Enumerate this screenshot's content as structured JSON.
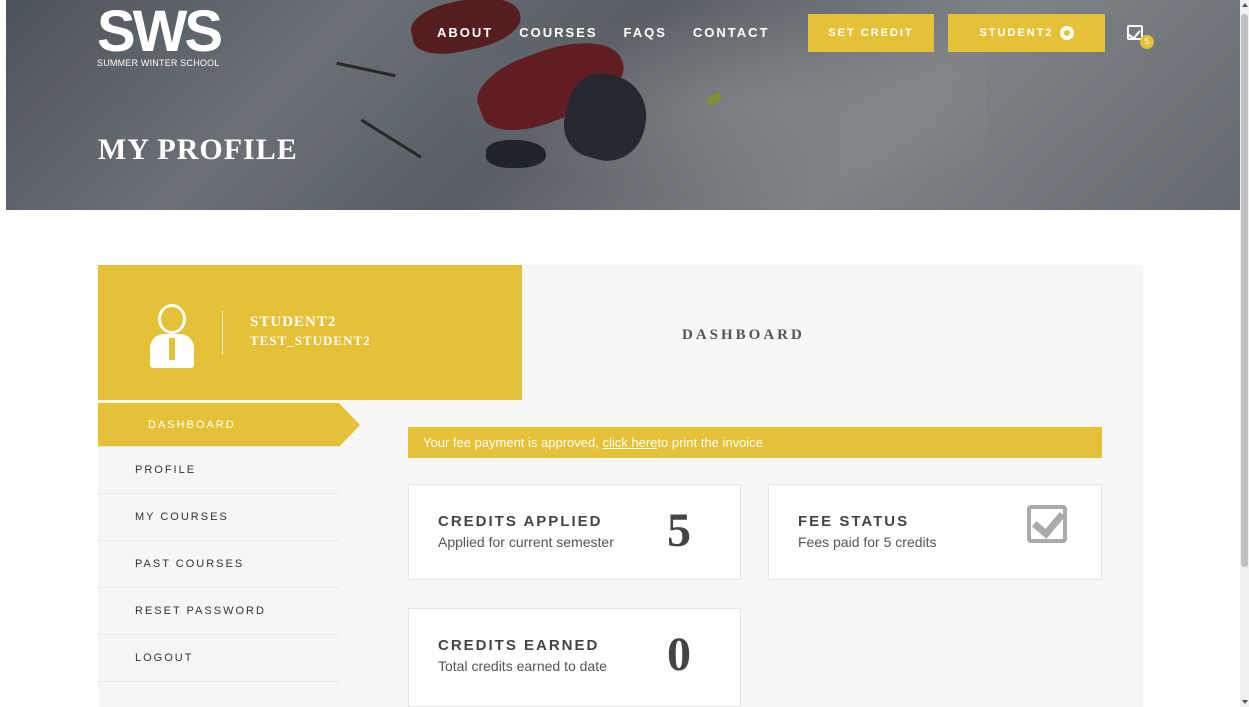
{
  "brand": {
    "logo_text": "SWS",
    "tagline": "SUMMER WINTER SCHOOL"
  },
  "nav": {
    "items": [
      "ABOUT",
      "COURSES",
      "FAQS",
      "CONTACT"
    ],
    "set_credit": "SET CREDIT",
    "user_menu": "STUDENT2",
    "tasks_badge": "5"
  },
  "page": {
    "title": "MY PROFILE"
  },
  "user": {
    "name": "STUDENT2",
    "username": "TEST_STUDENT2"
  },
  "main": {
    "heading": "DASHBOARD"
  },
  "sidebar": {
    "items": [
      {
        "label": "DASHBOARD",
        "active": true
      },
      {
        "label": "PROFILE"
      },
      {
        "label": "MY COURSES"
      },
      {
        "label": "PAST COURSES"
      },
      {
        "label": "RESET PASSWORD"
      },
      {
        "label": "LOGOUT"
      }
    ]
  },
  "notice": {
    "before": "Your fee payment is approved, ",
    "link": "click here",
    "after": " to print the invoice"
  },
  "cards": {
    "credits_applied": {
      "title": "CREDITS APPLIED",
      "subtitle": "Applied for current semester",
      "value": "5"
    },
    "fee_status": {
      "title": "FEE STATUS",
      "subtitle": "Fees paid for 5 credits",
      "icon": "check-square-icon"
    },
    "credits_earned": {
      "title": "CREDITS EARNED",
      "subtitle": "Total credits earned to date",
      "value": "0"
    }
  },
  "colors": {
    "accent": "#e5c137",
    "panel": "#f7f7f7"
  }
}
